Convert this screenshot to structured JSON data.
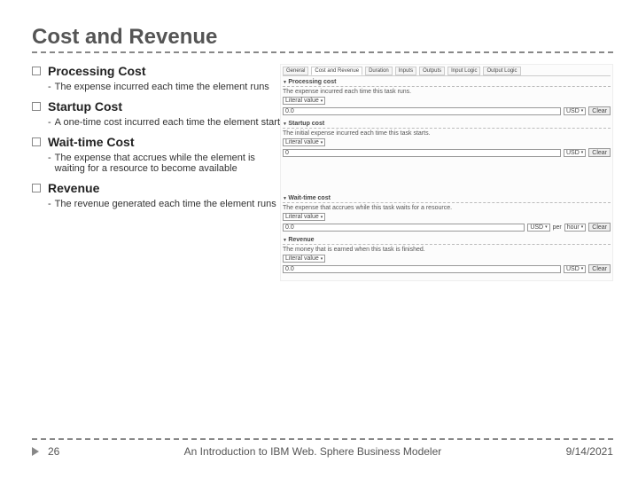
{
  "title": "Cost and Revenue",
  "sections": [
    {
      "title": "Processing Cost",
      "desc": "The expense incurred each time the element runs"
    },
    {
      "title": "Startup Cost",
      "desc": "A one-time cost incurred each time the element start"
    },
    {
      "title": "Wait-time Cost",
      "desc": "The expense that accrues while the element is waiting for a resource to become available"
    },
    {
      "title": "Revenue",
      "desc": "The revenue generated each time the element runs"
    }
  ],
  "footer": {
    "page": "26",
    "center": "An Introduction to IBM Web. Sphere Business Modeler",
    "date": "9/14/2021"
  },
  "panel": {
    "tabs": [
      "General",
      "Cost and Revenue",
      "Duration",
      "Inputs",
      "Outputs",
      "Input Logic",
      "Output Logic"
    ],
    "groups": {
      "processing": {
        "title": "Processing cost",
        "note": "The expense incurred each time this task runs.",
        "dd": "Literal value",
        "v1": "0.0",
        "cur": "USD",
        "btn": "Clear"
      },
      "startup": {
        "title": "Startup cost",
        "note": "The initial expense incurred each time this task starts.",
        "dd": "Literal value",
        "v1": "0",
        "cur": "USD",
        "btn": "Clear"
      },
      "wait": {
        "title": "Wait-time cost",
        "note": "The expense that accrues while this task waits for a resource.",
        "dd": "Literal value",
        "v1": "0.0",
        "cur": "USD",
        "per": "per",
        "tu": "hour",
        "btn": "Clear"
      },
      "revenue": {
        "title": "Revenue",
        "note": "The money that is earned when this task is finished.",
        "dd": "Literal value",
        "v1": "0.0",
        "cur": "USD",
        "btn": "Clear"
      }
    }
  }
}
